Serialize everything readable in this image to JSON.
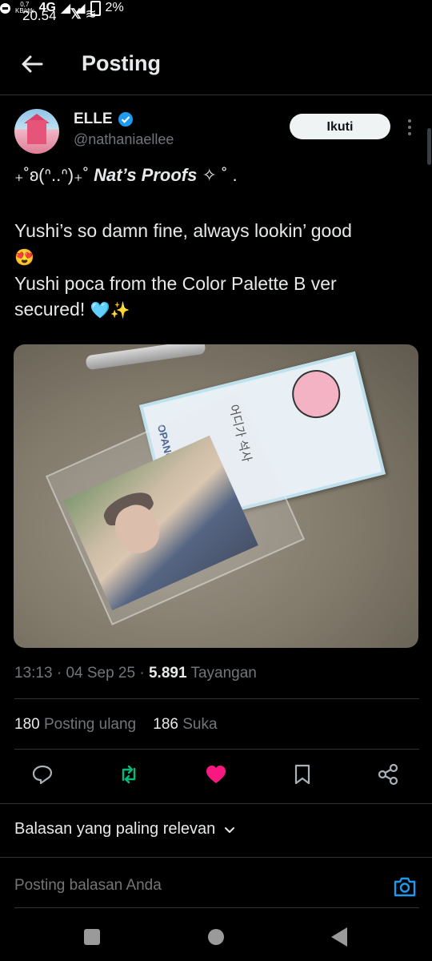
{
  "status_bar": {
    "time": "20.54",
    "network_speed_value": "0,7",
    "network_speed_unit": "KB/dtk",
    "network_type": "4G",
    "battery": "2%"
  },
  "header": {
    "title": "Posting"
  },
  "author": {
    "name": "ELLE",
    "handle": "@nathaniaellee",
    "follow_label": "Ikuti"
  },
  "tweet": {
    "deco_prefix": "₊˚ʚ(ᐢ..ᐢ)₊˚",
    "deco_title": "Nat’s Proofs",
    "deco_suffix": "✧ ˚ .",
    "line1": "Yushi’s so damn fine, always lookin’ good",
    "line1_emoji": "😍",
    "line2": "Yushi poca from the Color Palette B ver",
    "line3": "secured!",
    "line3_emoji": "🩵✨",
    "image_text": {
      "brand": "OPANCHU USAGI",
      "handwriting": "어디가 석사"
    }
  },
  "meta": {
    "time": "13:13",
    "date": "04 Sep 25",
    "views_count": "5.891",
    "views_label": "Tayangan"
  },
  "stats": {
    "reposts_count": "180",
    "reposts_label": "Posting ulang",
    "likes_count": "186",
    "likes_label": "Suka"
  },
  "replies": {
    "sort_label": "Balasan yang paling relevan",
    "input_placeholder": "Posting balasan Anda"
  },
  "colors": {
    "background": "#000000",
    "verified": "#1d9bf0",
    "repost": "#00ba7c",
    "like": "#f91880",
    "muted": "#71767b"
  }
}
